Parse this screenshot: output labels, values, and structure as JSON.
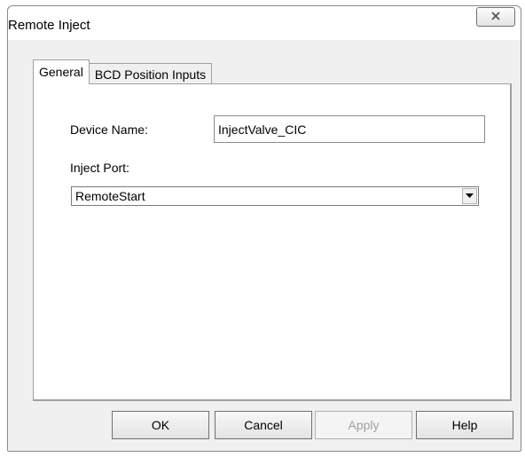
{
  "window": {
    "title": "Remote Inject",
    "close_icon": "close-x-icon"
  },
  "tabs": [
    {
      "label": "General",
      "active": true
    },
    {
      "label": "BCD Position Inputs",
      "active": false
    }
  ],
  "general": {
    "device_name_label": "Device Name:",
    "device_name_value": "InjectValve_CIC",
    "inject_port_label": "Inject Port:",
    "inject_port_value": "RemoteStart",
    "dropdown_icon": "dropdown-arrow-icon"
  },
  "buttons": {
    "ok": "OK",
    "cancel": "Cancel",
    "apply": "Apply",
    "help": "Help"
  }
}
